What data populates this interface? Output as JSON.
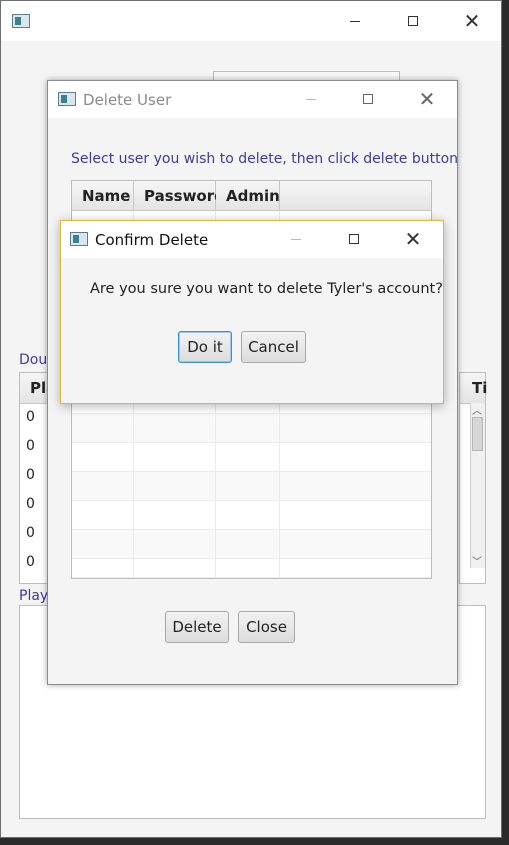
{
  "main_window": {
    "bg_labels": [
      "Dou",
      "Play"
    ],
    "right_column_header": "Ti",
    "bg_cells": [
      "0",
      "0",
      "0",
      "0",
      "0",
      "0"
    ],
    "bg_header_first": "Pla"
  },
  "delete_user": {
    "title": "Delete User",
    "instruction": "Select user you wish to delete, then click delete button",
    "columns": [
      "Name",
      "Password",
      "Admin"
    ],
    "delete_label": "Delete",
    "close_label": "Close"
  },
  "confirm": {
    "title": "Confirm Delete",
    "message": "Are you sure you want to delete Tyler's account?",
    "do_it_label": "Do it",
    "cancel_label": "Cancel"
  },
  "icons": {
    "app": "app-window-icon",
    "minimize": "minimize-icon",
    "maximize": "maximize-icon",
    "close": "close-icon"
  }
}
